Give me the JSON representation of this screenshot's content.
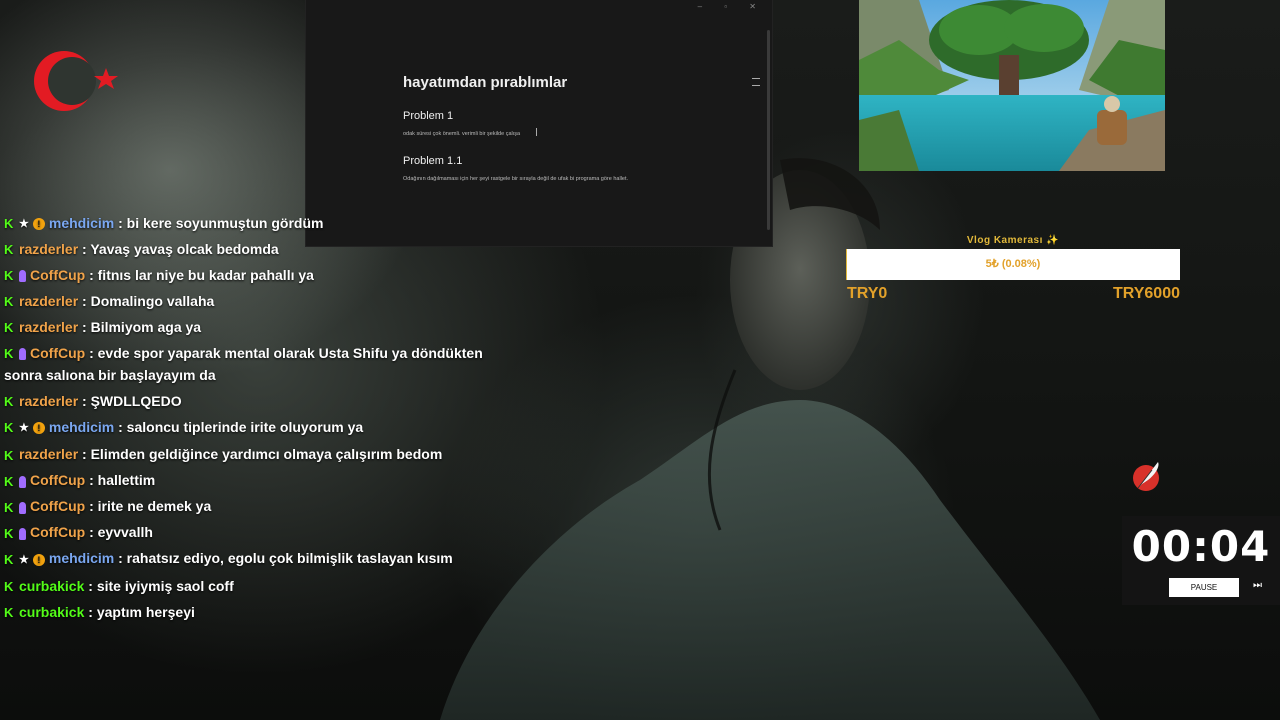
{
  "notes": {
    "title": "hayatımdan pırablımlar",
    "sections": [
      {
        "heading": "Problem 1",
        "body": "odak süresi çok önemli. verimli bir şekilde çalışa"
      },
      {
        "heading": "Problem 1.1",
        "body": "Odağının dağılmaması için her şeyi rastgele bir sırayla değil de ufak bi programa göre hallet."
      }
    ]
  },
  "donation_goal": {
    "title": "Vlog Kamerası ✨",
    "progress_label": "5₺ (0.08%)",
    "progress_fraction": 0.0008,
    "min_label": "TRY0",
    "max_label": "TRY6000",
    "accent_color": "#e2b93b"
  },
  "timer": {
    "display": "00:04",
    "pause_label": "PAUSE",
    "next_glyph": "⏭"
  },
  "user_colors": {
    "mehdicim": "#7aa7f0",
    "razderler": "#f0a34a",
    "CoffCup": "#f0a34a",
    "curbakick": "#53fc18"
  },
  "chat": [
    {
      "user": "mehdicim",
      "text": ": bi kere soyunmuştun gördüm",
      "badges": [
        "k",
        "star",
        "warn"
      ]
    },
    {
      "user": "razderler",
      "text": ": Yavaş yavaş olcak bedomda",
      "badges": [
        "k"
      ]
    },
    {
      "user": "CoffCup",
      "text": ": fitnıs lar niye bu kadar pahallı ya",
      "badges": [
        "k",
        "sub"
      ]
    },
    {
      "user": "razderler",
      "text": ": Domalingo vallaha",
      "badges": [
        "k"
      ]
    },
    {
      "user": "razderler",
      "text": ": Bilmiyom aga ya",
      "badges": [
        "k"
      ]
    },
    {
      "user": "CoffCup",
      "text": ": evde spor yaparak mental olarak Usta Shifu ya döndükten sonra salıona bir başlayayım da",
      "badges": [
        "k",
        "sub"
      ]
    },
    {
      "user": "razderler",
      "text": ": ŞWDLLQEDO",
      "badges": [
        "k"
      ]
    },
    {
      "user": "mehdicim",
      "text": ": saloncu tiplerinde irite oluyorum ya",
      "badges": [
        "k",
        "star",
        "warn"
      ]
    },
    {
      "user": "razderler",
      "text": ": Elimden geldiğince yardımcı olmaya çalışırım bedom",
      "badges": [
        "k"
      ]
    },
    {
      "user": "CoffCup",
      "text": ": hallettim",
      "badges": [
        "k",
        "sub"
      ]
    },
    {
      "user": "CoffCup",
      "text": ": irite ne demek ya",
      "badges": [
        "k",
        "sub"
      ]
    },
    {
      "user": "CoffCup",
      "text": ": eyvvallh",
      "badges": [
        "k",
        "sub"
      ]
    },
    {
      "user": "mehdicim",
      "text": ": rahatsız ediyo, egolu çok bilmişlik taslayan kısım",
      "badges": [
        "k",
        "star",
        "warn"
      ]
    },
    {
      "user": "curbakick",
      "text": ": site iyiymiş saol coff",
      "badges": [
        "k"
      ]
    },
    {
      "user": "curbakick",
      "text": ": yaptım herşeyi",
      "badges": [
        "k"
      ]
    }
  ]
}
